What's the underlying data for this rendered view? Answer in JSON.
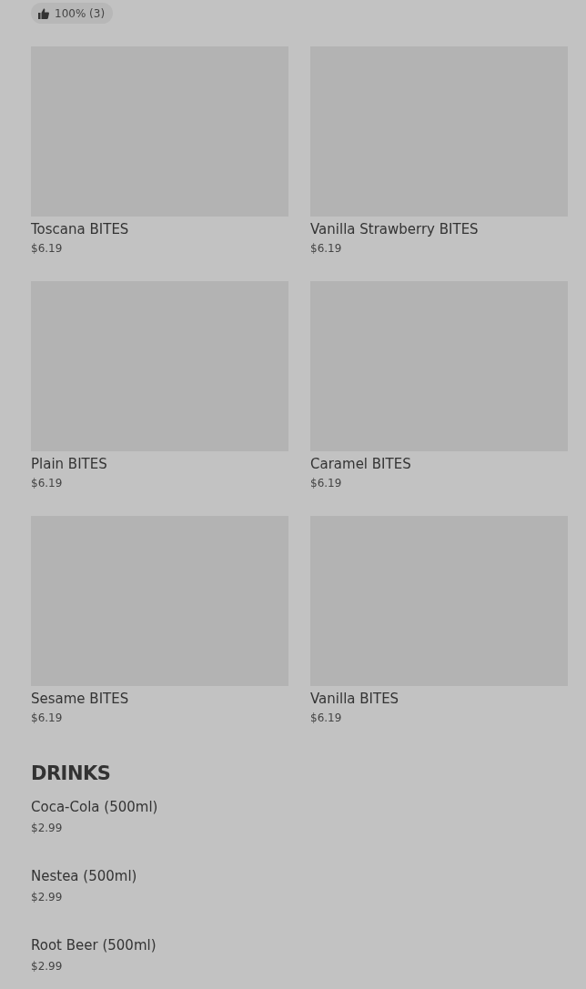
{
  "rating_badge": {
    "text": "100% (3)"
  },
  "items": [
    {
      "name": "Toscana BITES",
      "price": "$6.19"
    },
    {
      "name": "Vanilla Strawberry BITES",
      "price": "$6.19"
    },
    {
      "name": "Plain BITES",
      "price": "$6.19"
    },
    {
      "name": "Caramel BITES",
      "price": "$6.19"
    },
    {
      "name": "Sesame BITES",
      "price": "$6.19"
    },
    {
      "name": "Vanilla BITES",
      "price": "$6.19"
    }
  ],
  "drinks": {
    "title": "DRINKS",
    "items": [
      {
        "name": "Coca-Cola (500ml)",
        "price": "$2.99"
      },
      {
        "name": "Nestea (500ml)",
        "price": "$2.99"
      },
      {
        "name": "Root Beer (500ml)",
        "price": "$2.99"
      }
    ]
  }
}
